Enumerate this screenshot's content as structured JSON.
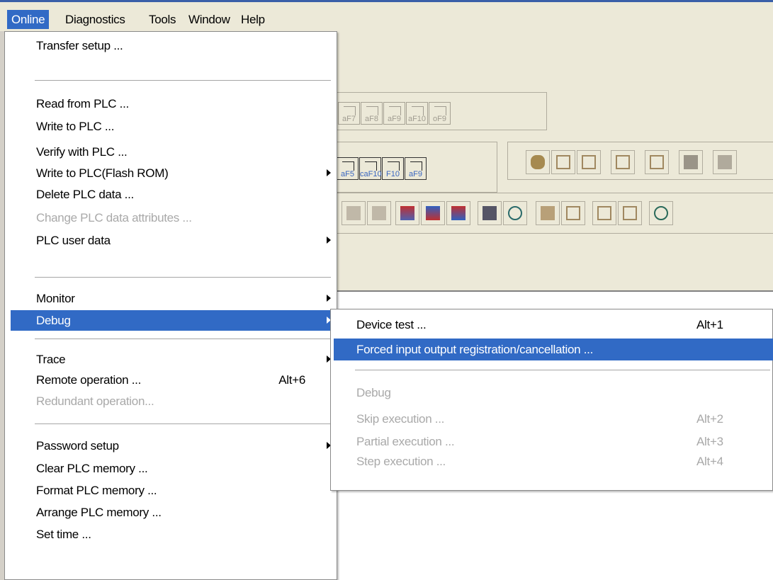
{
  "menubar": {
    "items": [
      "Online",
      "Diagnostics",
      "Tools",
      "Window",
      "Help"
    ]
  },
  "toolbar": {
    "row1_keys": [
      "aF7",
      "aF8",
      "aF9",
      "aF10",
      "oF9"
    ],
    "row2_keys": [
      "aF5",
      "caF10",
      "F10",
      "aF9"
    ]
  },
  "online_menu": {
    "items": [
      {
        "label": "Transfer setup ..."
      },
      {
        "label": "Read from PLC ..."
      },
      {
        "label": "Write to PLC ..."
      },
      {
        "label": "Verify with PLC ..."
      },
      {
        "label": "Write to PLC(Flash ROM)"
      },
      {
        "label": "Delete PLC data ..."
      },
      {
        "label": "Change PLC data attributes ..."
      },
      {
        "label": "PLC user data"
      },
      {
        "label": "Monitor"
      },
      {
        "label": "Debug"
      },
      {
        "label": "Trace"
      },
      {
        "label": "Remote operation ...",
        "shortcut": "Alt+6"
      },
      {
        "label": "Redundant operation..."
      },
      {
        "label": "Password setup"
      },
      {
        "label": "Clear PLC memory ..."
      },
      {
        "label": "Format PLC memory ..."
      },
      {
        "label": "Arrange PLC memory ..."
      },
      {
        "label": "Set time ..."
      }
    ]
  },
  "debug_submenu": {
    "items": [
      {
        "label": "Device test ...",
        "shortcut": "Alt+1"
      },
      {
        "label": "Forced input output registration/cancellation ..."
      },
      {
        "label": "Debug"
      },
      {
        "label": "Skip execution ...",
        "shortcut": "Alt+2"
      },
      {
        "label": "Partial execution ...",
        "shortcut": "Alt+3"
      },
      {
        "label": "Step execution ...",
        "shortcut": "Alt+4"
      }
    ]
  },
  "colors": {
    "highlight": "#316ac5",
    "menubar_bg": "#ece9d8",
    "disabled_text": "#a9a9a9"
  }
}
